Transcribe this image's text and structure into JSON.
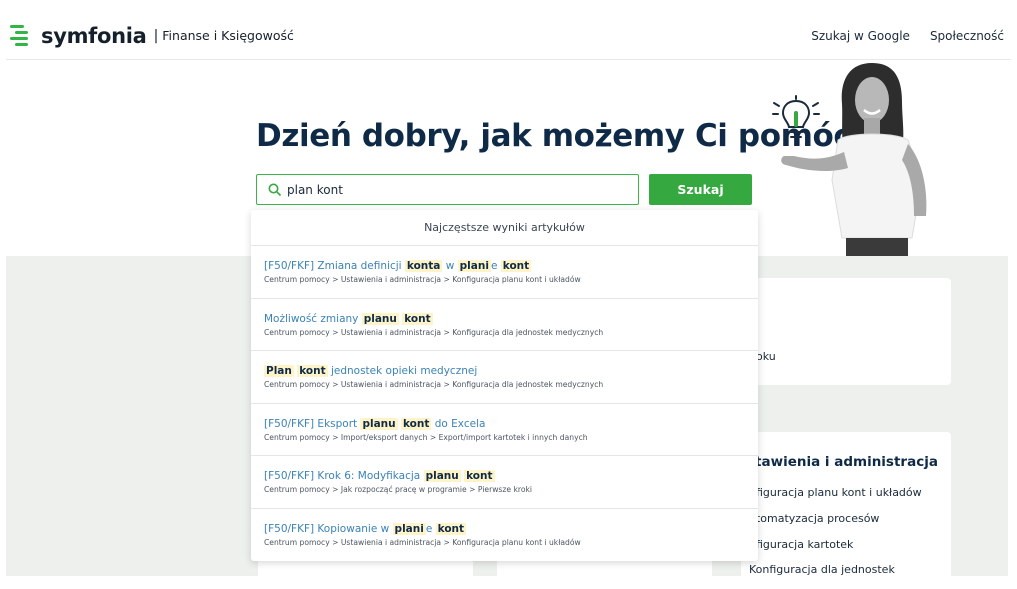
{
  "header": {
    "logo_word": "symfonia",
    "logo_sep": "|",
    "logo_sub": "Finanse i Księgowość",
    "nav": [
      "Szukaj w Google",
      "Społeczność"
    ]
  },
  "hero": {
    "title": "Dzień dobry, jak możemy Ci pomóc?"
  },
  "search": {
    "value": "plan kont",
    "button": "Szukaj"
  },
  "dropdown": {
    "header": "Najczęstsze wyniki artykułów",
    "results": [
      {
        "title": [
          {
            "t": "[F50/FKF] Zmiana definicji ",
            "h": false
          },
          {
            "t": "konta",
            "h": true
          },
          {
            "t": " w ",
            "h": false
          },
          {
            "t": "plani",
            "h": true
          },
          {
            "t": "e ",
            "h": false
          },
          {
            "t": "kont",
            "h": true
          }
        ],
        "path": "Centrum pomocy > Ustawienia i administracja > Konfiguracja planu kont i układów"
      },
      {
        "title": [
          {
            "t": "Możliwość zmiany ",
            "h": false
          },
          {
            "t": "planu",
            "h": true
          },
          {
            "t": " ",
            "h": false
          },
          {
            "t": "kont",
            "h": true
          }
        ],
        "path": "Centrum pomocy > Ustawienia i administracja > Konfiguracja dla jednostek medycznych"
      },
      {
        "title": [
          {
            "t": "Plan",
            "h": true
          },
          {
            "t": " ",
            "h": false
          },
          {
            "t": "kont",
            "h": true
          },
          {
            "t": " jednostek opieki medycznej",
            "h": false
          }
        ],
        "path": "Centrum pomocy > Ustawienia i administracja > Konfiguracja dla jednostek medycznych"
      },
      {
        "title": [
          {
            "t": "[F50/FKF] Eksport ",
            "h": false
          },
          {
            "t": "planu",
            "h": true
          },
          {
            "t": " ",
            "h": false
          },
          {
            "t": "kont",
            "h": true
          },
          {
            "t": " do Excela",
            "h": false
          }
        ],
        "path": "Centrum pomocy > Import/eksport danych > Export/import kartotek i innych danych"
      },
      {
        "title": [
          {
            "t": "[F50/FKF] Krok 6: Modyfikacja ",
            "h": false
          },
          {
            "t": "planu",
            "h": true
          },
          {
            "t": " ",
            "h": false
          },
          {
            "t": "kont",
            "h": true
          }
        ],
        "path": "Centrum pomocy > Jak rozpocząć pracę w programie > Pierwsze kroki"
      },
      {
        "title": [
          {
            "t": "[F50/FKF] Kopiowanie w ",
            "h": false
          },
          {
            "t": "plani",
            "h": true
          },
          {
            "t": "e ",
            "h": false
          },
          {
            "t": "kont",
            "h": true
          }
        ],
        "path": "Centrum pomocy > Ustawienia i administracja > Konfiguracja planu kont i układów"
      }
    ]
  },
  "background": {
    "card_a_text": "oku",
    "card_b_title": "stawienia i administracja",
    "card_b_items": [
      "nfiguracja planu kont i układów",
      "utomatyzacja procesów",
      "nfiguracja kartotek",
      "Konfiguracja dla jednostek"
    ]
  },
  "colors": {
    "brand_green": "#36a840",
    "title_navy": "#0e2a47",
    "link_blue": "#3b82b5",
    "highlight": "#fff3c8"
  }
}
